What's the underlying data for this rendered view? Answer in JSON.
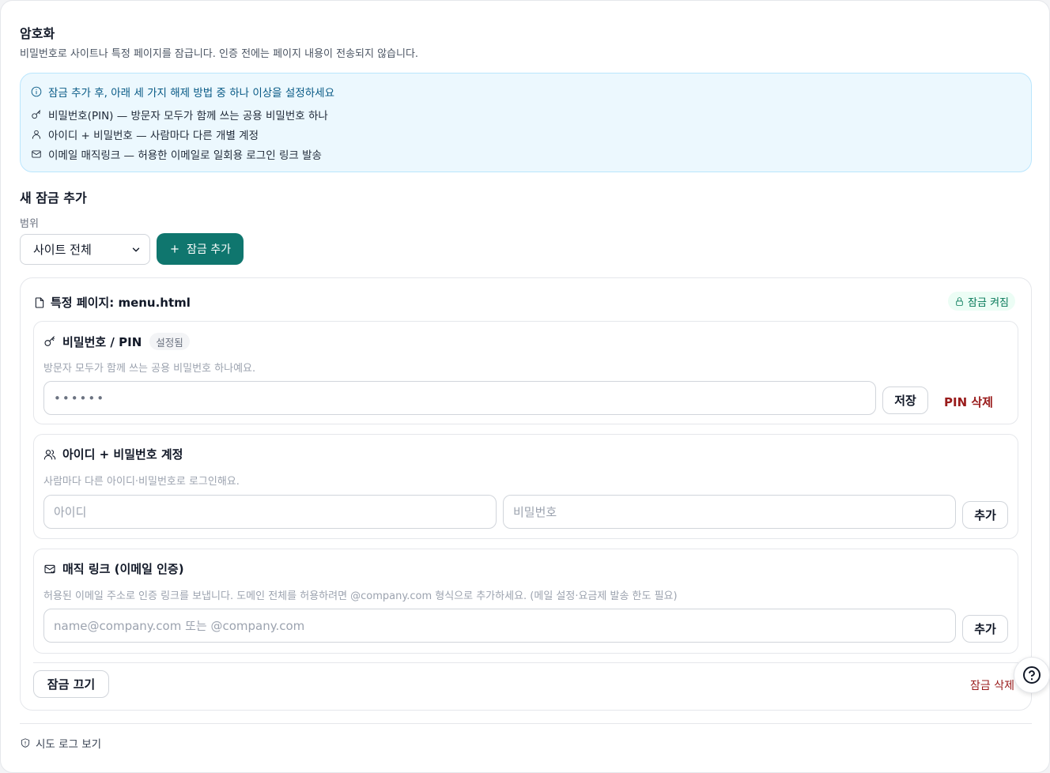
{
  "header": {
    "title": "암호화",
    "description": "비밀번호로 사이트나 특정 페이지를 잠급니다. 인증 전에는 페이지 내용이 전송되지 않습니다."
  },
  "info": {
    "heading": "잠금 추가 후, 아래 세 가지 해제 방법 중 하나 이상을 설정하세요",
    "items": [
      {
        "icon": "key-icon",
        "text": "비밀번호(PIN) — 방문자 모두가 함께 쓰는 공용 비밀번호 하나"
      },
      {
        "icon": "user-icon",
        "text": "아이디 + 비밀번호 — 사람마다 다른 개별 계정"
      },
      {
        "icon": "mail-icon",
        "text": "이메일 매직링크 — 허용한 이메일로 일회용 로그인 링크 발송"
      }
    ]
  },
  "new_lock": {
    "title": "새 잠금 추가",
    "scope_label": "범위",
    "scope_value": "사이트 전체",
    "add_button": "잠금 추가"
  },
  "lock_card": {
    "title": "특정 페이지: menu.html",
    "status": "잠금 켜짐",
    "pin": {
      "title": "비밀번호 / PIN",
      "badge": "설정됨",
      "description": "방문자 모두가 함께 쓰는 공용 비밀번호 하나예요.",
      "value": "••••••",
      "save_button": "저장",
      "delete_button": "PIN 삭제"
    },
    "accounts": {
      "title": "아이디 + 비밀번호 계정",
      "description": "사람마다 다른 아이디·비밀번호로 로그인해요.",
      "id_placeholder": "아이디",
      "password_placeholder": "비밀번호",
      "add_button": "추가"
    },
    "magic_link": {
      "title": "매직 링크 (이메일 인증)",
      "description": "허용된 이메일 주소로 인증 링크를 보냅니다. 도메인 전체를 허용하려면 @company.com 형식으로 추가하세요. (메일 설정·요금제 발송 한도 필요)",
      "email_placeholder": "name@company.com 또는 @company.com",
      "add_button": "추가"
    },
    "disable_button": "잠금 끄기",
    "delete_button": "잠금 삭제"
  },
  "footer": {
    "log_link": "시도 로그 보기"
  },
  "colors": {
    "primary": "#0f766e",
    "danger": "#991b1b",
    "info_bg": "#ecf8fe",
    "success": "#047857"
  }
}
